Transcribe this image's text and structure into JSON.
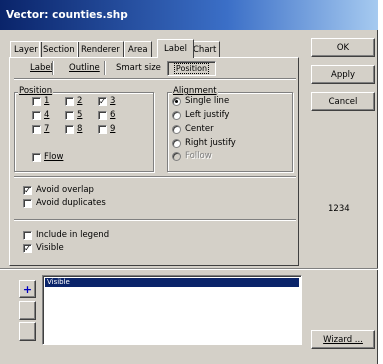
{
  "window": {
    "title": "Vector: counties.shp"
  },
  "main_tabs": [
    {
      "label": "Layer"
    },
    {
      "label": "Section"
    },
    {
      "label": "Renderer"
    },
    {
      "label": "Area"
    },
    {
      "label": "Label"
    },
    {
      "label": "Chart"
    }
  ],
  "sub_tabs": [
    {
      "label": "Label"
    },
    {
      "label": "Outline"
    },
    {
      "label": "Smart size"
    },
    {
      "label": "Position"
    }
  ],
  "position_group": {
    "title": "Position",
    "options": [
      {
        "label": "1",
        "checked": false
      },
      {
        "label": "2",
        "checked": false
      },
      {
        "label": "3",
        "checked": true
      },
      {
        "label": "4",
        "checked": false
      },
      {
        "label": "5",
        "checked": false
      },
      {
        "label": "6",
        "checked": false
      },
      {
        "label": "7",
        "checked": false
      },
      {
        "label": "8",
        "checked": false
      },
      {
        "label": "9",
        "checked": false
      }
    ],
    "flow": {
      "label": "Flow",
      "checked": false
    }
  },
  "alignment_group": {
    "title": "Alignment",
    "options": [
      {
        "label": "Single line",
        "selected": true,
        "enabled": true
      },
      {
        "label": "Left justify",
        "selected": false,
        "enabled": true
      },
      {
        "label": "Center",
        "selected": false,
        "enabled": true
      },
      {
        "label": "Right justify",
        "selected": false,
        "enabled": true
      },
      {
        "label": "Follow",
        "selected": false,
        "enabled": false
      }
    ]
  },
  "overlap": {
    "avoid_overlap": {
      "label": "Avoid overlap",
      "checked": true
    },
    "avoid_duplicates": {
      "label": "Avoid duplicates",
      "checked": false
    }
  },
  "legend_opts": {
    "include_in_legend": {
      "label": "Include in legend",
      "checked": false
    },
    "visible": {
      "label": "Visible",
      "checked": true
    }
  },
  "buttons": {
    "ok": "OK",
    "apply": "Apply",
    "cancel": "Cancel",
    "wizard": "Wizard ..."
  },
  "preview_text": "1234",
  "list": {
    "add_symbol": "+",
    "items": [
      "Visible"
    ]
  },
  "colors": {
    "title_start": "#0a246a",
    "title_end": "#a6caf0",
    "face": "#d4d0c8",
    "selection": "#0a246a"
  }
}
